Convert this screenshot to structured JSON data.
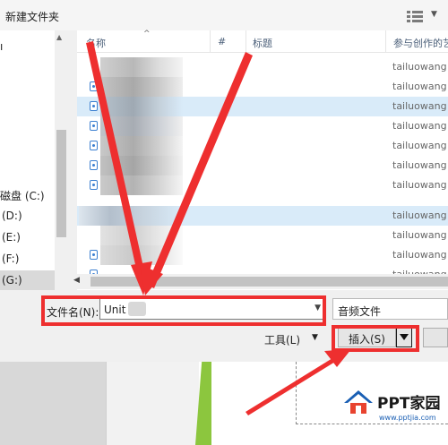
{
  "toolbar": {
    "new_folder": "新建文件夹"
  },
  "nav": {
    "items": [
      {
        "label": "磁盘 (C:)",
        "selected": false
      },
      {
        "label": "(D:)",
        "selected": false
      },
      {
        "label": "(E:)",
        "selected": false
      },
      {
        "label": "(F:)",
        "selected": false
      },
      {
        "label": "(G:)",
        "selected": true
      }
    ]
  },
  "columns": {
    "name": "名称",
    "number": "#",
    "title": "标题",
    "contributor": "参与创作的艺"
  },
  "rows": [
    {
      "author": "tailuowang",
      "selected": false
    },
    {
      "author": "tailuowang",
      "selected": false
    },
    {
      "author": "tailuowang",
      "selected": true
    },
    {
      "author": "tailuowang",
      "selected": false
    },
    {
      "author": "tailuowang",
      "selected": false
    },
    {
      "author": "tailuowang",
      "selected": false
    },
    {
      "author": "tailuowang",
      "selected": false
    },
    {
      "author": "tailuowang",
      "selected": true
    },
    {
      "author": "tailuowang",
      "selected": false
    },
    {
      "author": "tailuowang",
      "selected": false
    },
    {
      "author": "tailuowang",
      "selected": false
    }
  ],
  "form": {
    "filename_label": "文件名(N):",
    "filename_value": "Unit",
    "filetype": "音频文件",
    "tools_label": "工具(L)",
    "insert_label": "插入(S)"
  },
  "watermark": {
    "brand": "PPT家园",
    "url": "www.pptjia.com"
  },
  "colors": {
    "annotation": "#ee2f2f",
    "selection": "#d9ebf9",
    "accent_green": "#8cc63e"
  }
}
